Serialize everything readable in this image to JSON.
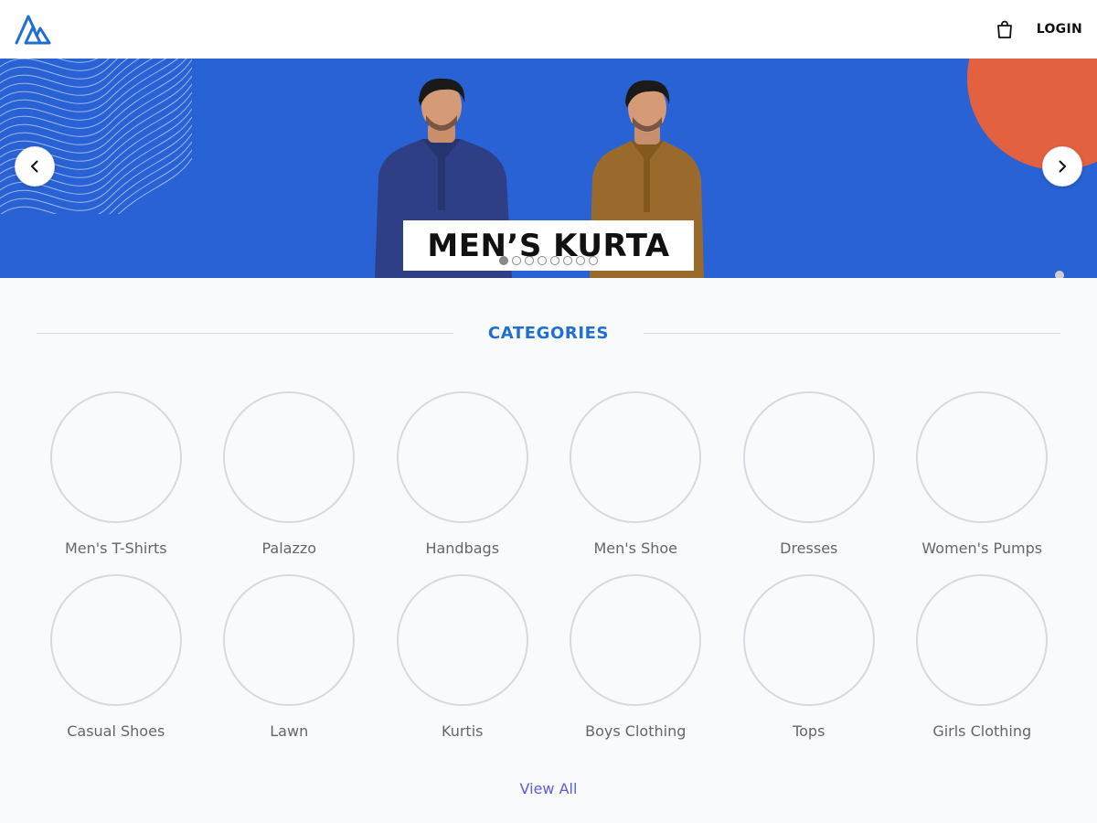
{
  "header": {
    "logo_icon": "triangle-stripes-logo-icon",
    "bag_icon": "shopping-bag-icon",
    "login_label": "LOGIN"
  },
  "hero": {
    "banner_text": "MEN’S KURTA",
    "prev_icon": "chevron-left-icon",
    "next_icon": "chevron-right-icon",
    "slide_count": 8,
    "active_slide": 1,
    "colors": {
      "background": "#2962d4",
      "accent_circle": "#e4613f",
      "kurta_navy": "#2f3f86",
      "kurta_brown": "#9a6a2c"
    }
  },
  "categories": {
    "heading": "CATEGORIES",
    "items": [
      {
        "label": "Men's T-Shirts"
      },
      {
        "label": "Palazzo"
      },
      {
        "label": "Handbags"
      },
      {
        "label": "Men's Shoe"
      },
      {
        "label": "Dresses"
      },
      {
        "label": "Women's Pumps"
      },
      {
        "label": "Casual Shoes"
      },
      {
        "label": "Lawn"
      },
      {
        "label": "Kurtis"
      },
      {
        "label": "Boys Clothing"
      },
      {
        "label": "Tops"
      },
      {
        "label": "Girls Clothing"
      }
    ],
    "view_all_label": "View All"
  },
  "colors": {
    "heading_blue": "#1f6fd1",
    "link_purple": "#5b5ed6",
    "page_bg": "#f8fafc"
  }
}
